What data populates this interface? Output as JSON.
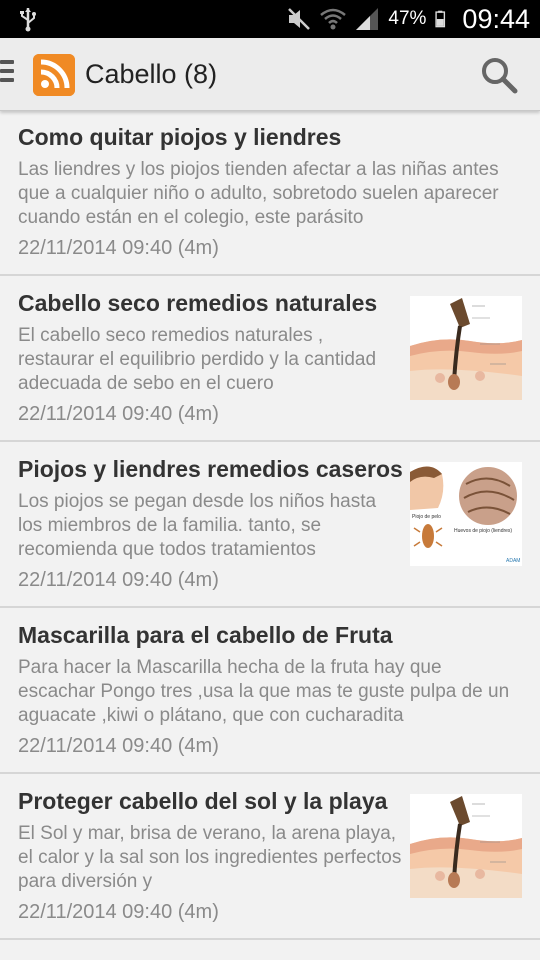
{
  "status_bar": {
    "battery_percent": "47%",
    "time": "09:44",
    "icons": [
      "usb-icon",
      "mute-icon",
      "wifi-icon",
      "signal-icon",
      "battery-icon"
    ]
  },
  "action_bar": {
    "title": "Cabello (8)",
    "icons": [
      "drawer-menu-icon",
      "rss-icon",
      "search-icon"
    ],
    "accent_color": "#f08a24"
  },
  "articles": [
    {
      "title": "Como quitar piojos y liendres",
      "summary": "Las liendres y los piojos tienden afectar a las niñas antes que a cualquier niño o adulto, sobretodo suelen aparecer cuando están en el colegio, este parásito",
      "date": "22/11/2014 09:40 (4m)",
      "thumbnail": null
    },
    {
      "title": "Cabello seco remedios naturales",
      "summary": "El cabello seco remedios naturales , restaurar el equilibrio perdido y la cantidad adecuada de sebo en el cuero",
      "date": "22/11/2014 09:40 (4m)",
      "thumbnail": "hair-follicle-diagram"
    },
    {
      "title": "Piojos y liendres remedios caseros",
      "summary": "Los piojos se pegan desde los niños hasta los miembros de la familia. tanto, se recomienda que todos tratamientos",
      "date": "22/11/2014 09:40 (4m)",
      "thumbnail": "lice-illustration",
      "thumbnail_labels": [
        "Piojo de pelo",
        "Huevos de piojo (liendres)",
        "ADAM"
      ]
    },
    {
      "title": "Mascarilla para el cabello de Fruta",
      "summary": "Para hacer la Mascarilla hecha de la fruta hay que escachar Pongo tres ,usa la que mas te guste pulpa de un aguacate ,kiwi o plátano, que con cucharadita",
      "date": "22/11/2014 09:40 (4m)",
      "thumbnail": null
    },
    {
      "title": "Proteger cabello del sol y la playa",
      "summary": "El Sol y mar, brisa de verano, la arena playa, el calor y la sal son los ingredientes perfectos para diversión y",
      "date": "22/11/2014 09:40 (4m)",
      "thumbnail": "hair-follicle-diagram"
    }
  ]
}
